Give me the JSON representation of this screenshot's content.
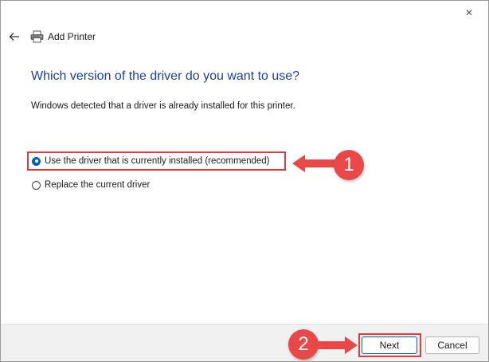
{
  "window": {
    "title": "Add Printer",
    "close_icon": "✕",
    "back_icon": "arrow-left-icon",
    "printer_icon": "printer-icon"
  },
  "page": {
    "heading": "Which version of the driver do you want to use?",
    "description": "Windows detected that a driver is already installed for this printer."
  },
  "options": [
    {
      "label": "Use the driver that is currently installed (recommended)",
      "selected": true
    },
    {
      "label": "Replace the current driver",
      "selected": false
    }
  ],
  "buttons": {
    "next": "Next",
    "cancel": "Cancel"
  },
  "annotations": {
    "step1": "1",
    "step2": "2",
    "color": "#e84848"
  }
}
